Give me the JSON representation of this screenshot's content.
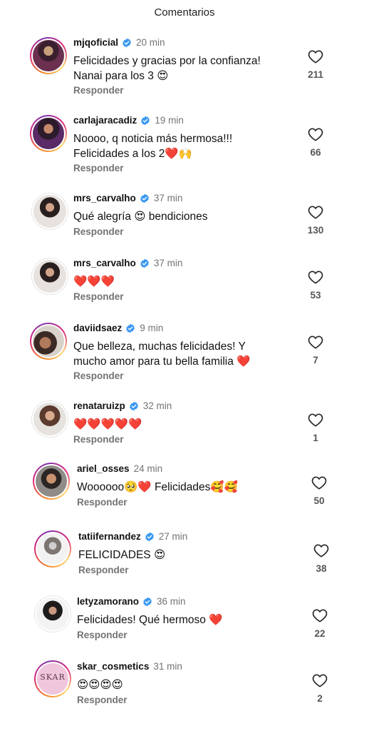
{
  "header": {
    "title": "Comentarios"
  },
  "icons": {
    "verified": "verified-badge-icon",
    "like": "heart-outline-icon"
  },
  "colors": {
    "verified": "#3897f0",
    "heart_emoji": "#e8185c",
    "secondary_text": "#737373"
  },
  "comments": [
    {
      "username": "mjqoficial",
      "verified": true,
      "time": "20 min",
      "line1": "Felicidades y gracias por la confianza!",
      "line2": "Nanai para los 3 😍",
      "reply": "Responder",
      "likes": "211"
    },
    {
      "username": "carlajaracadiz",
      "verified": true,
      "time": "19 min",
      "line1": "Noooo, q noticia más hermosa!!!",
      "line2": "Felicidades a los 2❤️🙌",
      "reply": "Responder",
      "likes": "66"
    },
    {
      "username": "mrs_carvalho",
      "verified": true,
      "time": "37 min",
      "line1": "Qué alegría 😍 bendiciones",
      "line2": "",
      "reply": "Responder",
      "likes": "130"
    },
    {
      "username": "mrs_carvalho",
      "verified": true,
      "time": "37 min",
      "line1": "❤️❤️❤️",
      "line2": "",
      "reply": "Responder",
      "likes": "53"
    },
    {
      "username": "daviidsaez",
      "verified": true,
      "time": "9 min",
      "line1": "Que belleza, muchas felicidades! Y",
      "line2": "mucho amor para tu bella familia ❤️",
      "reply": "Responder",
      "likes": "7"
    },
    {
      "username": "renataruizp",
      "verified": true,
      "time": "32 min",
      "line1": "❤️❤️❤️❤️❤️",
      "line2": "",
      "reply": "Responder",
      "likes": "1"
    },
    {
      "username": "ariel_osses",
      "verified": false,
      "time": "24 min",
      "line1": "Woooooo🥺❤️ Felicidades🥰🥰",
      "line2": "",
      "reply": "Responder",
      "likes": "50"
    },
    {
      "username": "tatiifernandez",
      "verified": true,
      "time": "27 min",
      "line1": "FELICIDADES 😍",
      "line2": "",
      "reply": "Responder",
      "likes": "38"
    },
    {
      "username": "letyzamorano",
      "verified": true,
      "time": "36 min",
      "line1": "Felicidades! Qué hermoso ❤️",
      "line2": "",
      "reply": "Responder",
      "likes": "22"
    },
    {
      "username": "skar_cosmetics",
      "verified": false,
      "time": "31 min",
      "line1": "😍😍😍😍",
      "line2": "",
      "reply": "Responder",
      "likes": "2",
      "avatar_logo": "SKAR"
    }
  ]
}
